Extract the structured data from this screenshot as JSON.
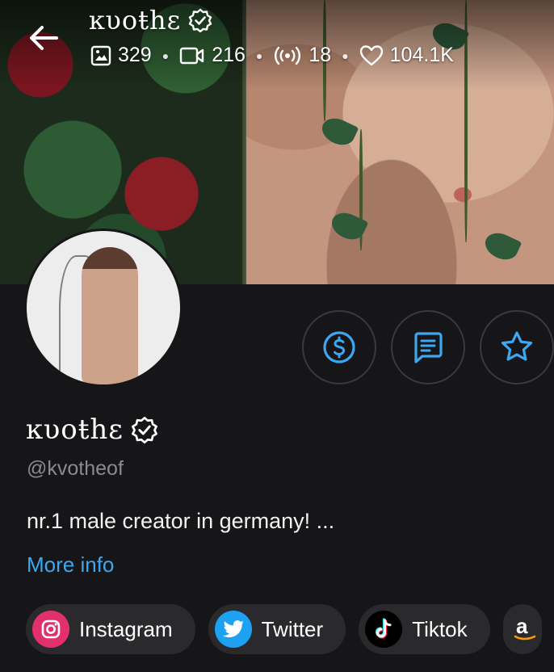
{
  "header": {
    "title": "ĸυoŧhɛ",
    "stats": {
      "photos": "329",
      "videos": "216",
      "streams": "18",
      "likes": "104.1K"
    }
  },
  "profile": {
    "name": "ĸυoŧhɛ",
    "handle": "@kvotheof",
    "bio": "nr.1 male creator in germany! ...",
    "more_info": "More info"
  },
  "actions": {
    "tip_icon": "dollar-circle-icon",
    "message_icon": "message-icon",
    "favorite_icon": "star-icon"
  },
  "socials": [
    {
      "label": "Instagram",
      "icon": "instagram-icon",
      "color": "#e1306c"
    },
    {
      "label": "Twitter",
      "icon": "twitter-icon",
      "color": "#1da1f2"
    },
    {
      "label": "Tiktok",
      "icon": "tiktok-icon",
      "color": "#000000"
    },
    {
      "label": "",
      "icon": "amazon-icon",
      "color": "#2a2a2d"
    }
  ],
  "colors": {
    "background": "#161618",
    "accent": "#3da7f2",
    "muted": "#8a8a8f"
  }
}
